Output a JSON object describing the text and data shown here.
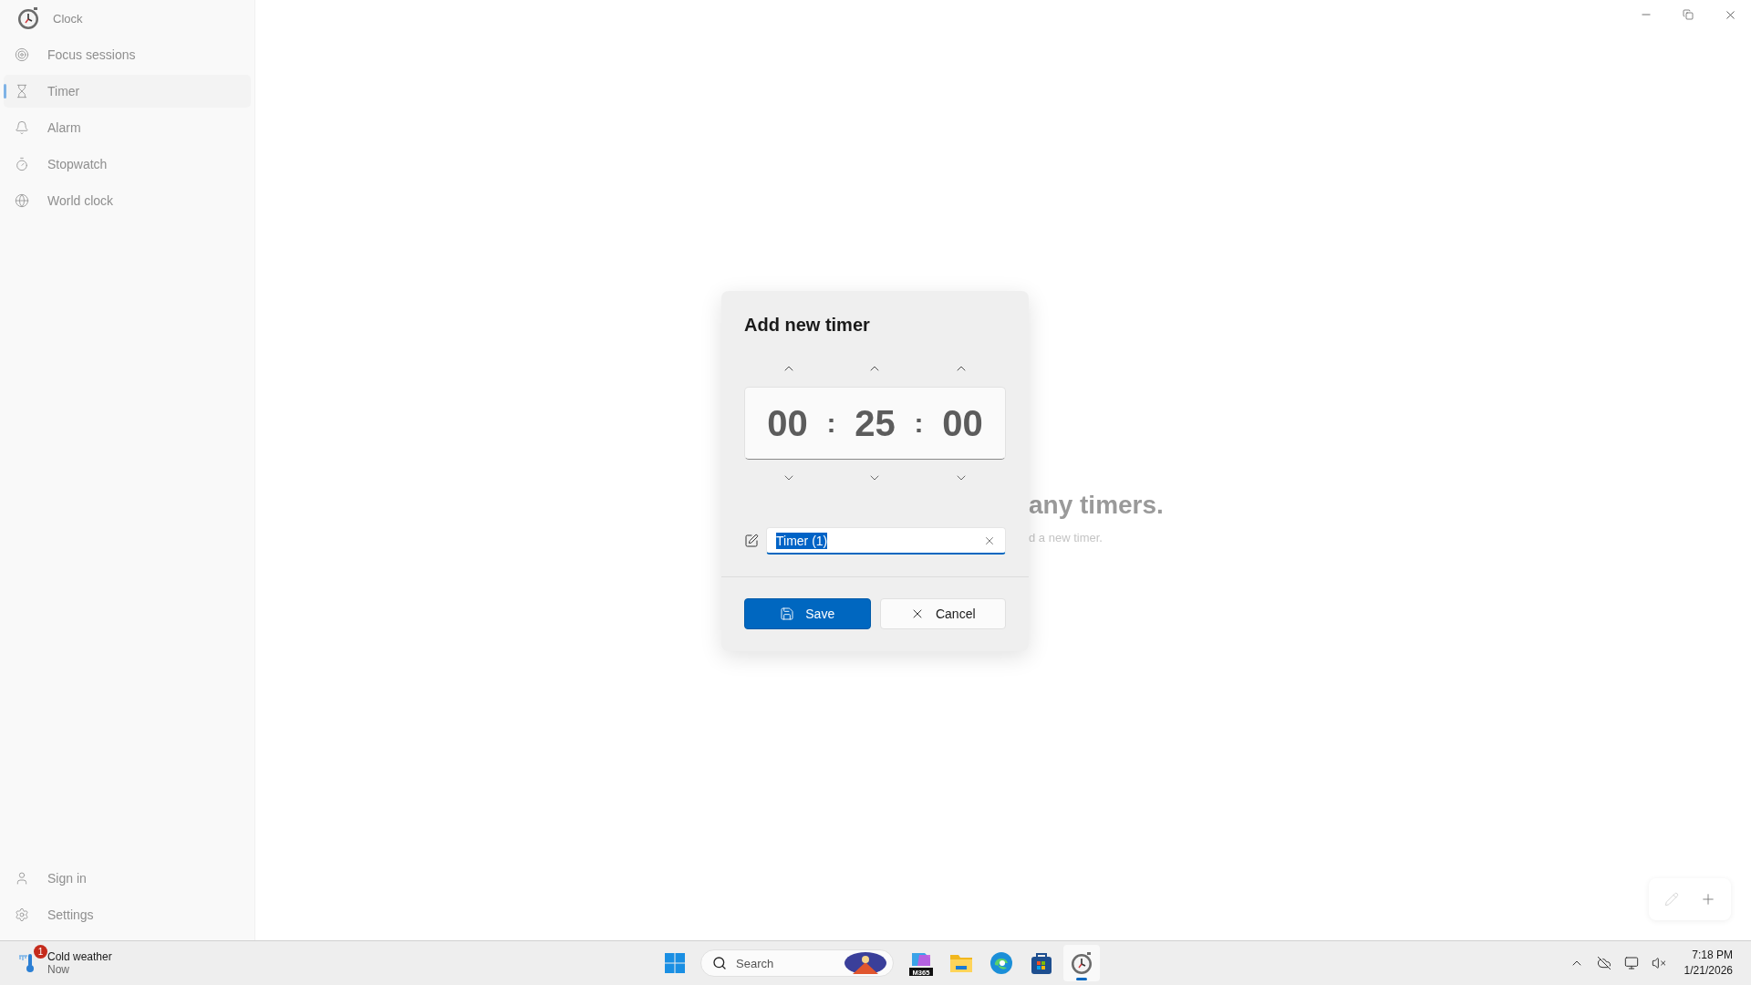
{
  "sidebar": {
    "app_title": "Clock",
    "items": [
      {
        "kind": "focus",
        "label": "Focus sessions",
        "selected": false
      },
      {
        "kind": "timer",
        "label": "Timer",
        "selected": true
      },
      {
        "kind": "alarm",
        "label": "Alarm",
        "selected": false
      },
      {
        "kind": "stopwatch",
        "label": "Stopwatch",
        "selected": false
      },
      {
        "kind": "world",
        "label": "World clock",
        "selected": false
      }
    ],
    "footer_items": [
      {
        "kind": "user",
        "label": "Sign in"
      },
      {
        "kind": "settings",
        "label": "Settings"
      }
    ]
  },
  "background_message": {
    "heading": "any timers.",
    "subtext": "d a new timer."
  },
  "dialog": {
    "title": "Add new timer",
    "time": [
      {
        "value": "00"
      },
      {
        "value": "25"
      },
      {
        "value": "00"
      }
    ],
    "separators": [
      ":",
      ":"
    ],
    "name_field": {
      "value": "Timer (1)",
      "text_selected": true
    },
    "buttons": [
      {
        "kind": "primary",
        "label": "Save"
      },
      {
        "kind": "secondary",
        "label": "Cancel"
      }
    ]
  },
  "taskbar": {
    "weather": {
      "badge": "1",
      "title": "Cold weather",
      "subtitle": "Now"
    },
    "search": {
      "label": "Search"
    },
    "apps": [
      {
        "kind": "copilot",
        "label": "M365",
        "active": false
      },
      {
        "kind": "folder",
        "active": false
      },
      {
        "kind": "edge",
        "active": false
      },
      {
        "kind": "store",
        "active": false
      },
      {
        "kind": "clock",
        "active": true
      }
    ],
    "clock": {
      "time": "7:18 PM",
      "date": "1/21/2026"
    }
  }
}
